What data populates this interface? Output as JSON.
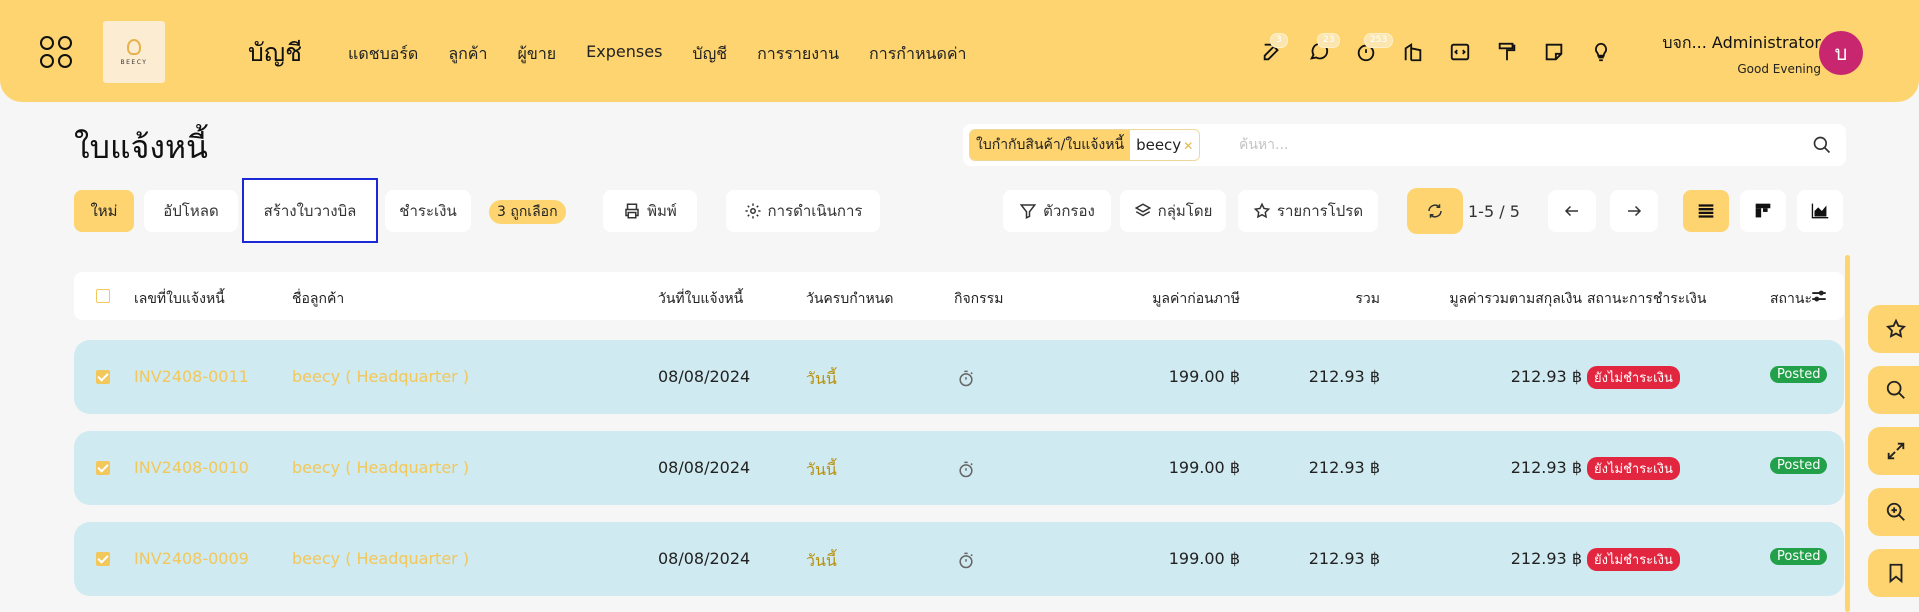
{
  "header": {
    "logo_text": "BEECY",
    "app_title": "บัญชี",
    "nav": [
      "แดชบอร์ด",
      "ลูกค้า",
      "ผู้ขาย",
      "Expenses",
      "บัญชี",
      "การรายงาน",
      "การกำหนดค่า"
    ],
    "icon_badges": {
      "activities": "3",
      "messages": "23",
      "timer": "253"
    },
    "user_name": "บจก... Administrator",
    "greeting": "Good Evening",
    "avatar_letter": "บ",
    "accent_color": "#fdd46f",
    "avatar_color": "#c8266e"
  },
  "page": {
    "title": "ใบแจ้งหนี้"
  },
  "search": {
    "facet_key": "ใบกำกับสินค้า/ใบแจ้งหนี้",
    "facet_value": "beecy",
    "placeholder": "ค้นหา..."
  },
  "toolbar": {
    "new": "ใหม่",
    "upload": "อัปโหลด",
    "create_bill": "สร้างใบวางบิล",
    "pay": "ชำระเงิน",
    "selected": "3 ถูกเลือก",
    "print": "พิมพ์",
    "action": "การดำเนินการ",
    "filters": "ตัวกรอง",
    "group_by": "กลุ่มโดย",
    "favorites": "รายการโปรด",
    "pager": "1-5 / 5"
  },
  "table": {
    "headers": {
      "number": "เลขที่ใบแจ้งหนี้",
      "customer": "ชื่อลูกค้า",
      "invoice_date": "วันที่ใบแจ้งหนี้",
      "due_date": "วันครบกำหนด",
      "activity": "กิจกรรม",
      "untaxed": "มูลค่าก่อนภาษี",
      "total": "รวม",
      "total_currency": "มูลค่ารวมตามสกุลเงิน",
      "payment_status": "สถานะการชำระเงิน",
      "status": "สถานะ"
    },
    "rows": [
      {
        "number": "INV2408-0011",
        "customer": "beecy ( Headquarter )",
        "invoice_date": "08/08/2024",
        "due": "วันนี้",
        "untaxed": "199.00 ฿",
        "total": "212.93 ฿",
        "total_currency": "212.93 ฿",
        "payment_status": "ยังไม่ชำระเงิน",
        "status": "Posted"
      },
      {
        "number": "INV2408-0010",
        "customer": "beecy ( Headquarter )",
        "invoice_date": "08/08/2024",
        "due": "วันนี้",
        "untaxed": "199.00 ฿",
        "total": "212.93 ฿",
        "total_currency": "212.93 ฿",
        "payment_status": "ยังไม่ชำระเงิน",
        "status": "Posted"
      },
      {
        "number": "INV2408-0009",
        "customer": "beecy ( Headquarter )",
        "invoice_date": "08/08/2024",
        "due": "วันนี้",
        "untaxed": "199.00 ฿",
        "total": "212.93 ฿",
        "total_currency": "212.93 ฿",
        "payment_status": "ยังไม่ชำระเงิน",
        "status": "Posted"
      }
    ]
  }
}
